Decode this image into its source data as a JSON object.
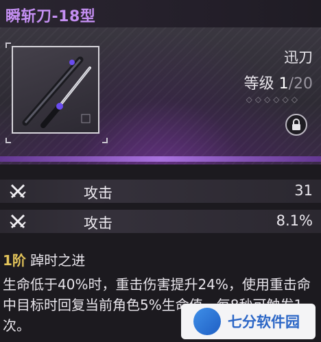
{
  "weapon": {
    "name": "瞬斩刀-18型",
    "type": "迅刀",
    "level_label": "等级",
    "level_current": "1",
    "level_max": "/20",
    "rank_stars": "◇◇◇◇◇◇"
  },
  "stats": [
    {
      "icon": "crossed-swords-icon",
      "name": "攻击",
      "value": "31"
    },
    {
      "icon": "crossed-swords-icon",
      "name": "攻击",
      "value": "8.1%"
    }
  ],
  "effect": {
    "rank": "1阶",
    "name": "踔时之进",
    "description": "生命低于40%时，重击伤害提升24%，使用重击命中目标时回复当前角色5%生命值，每8秒可触发1次。"
  },
  "watermark": {
    "text": "七分软件园"
  },
  "colors": {
    "title": "#c48ff2",
    "rank_gold": "#e3c45a",
    "accent_purple": "#b67df0"
  }
}
